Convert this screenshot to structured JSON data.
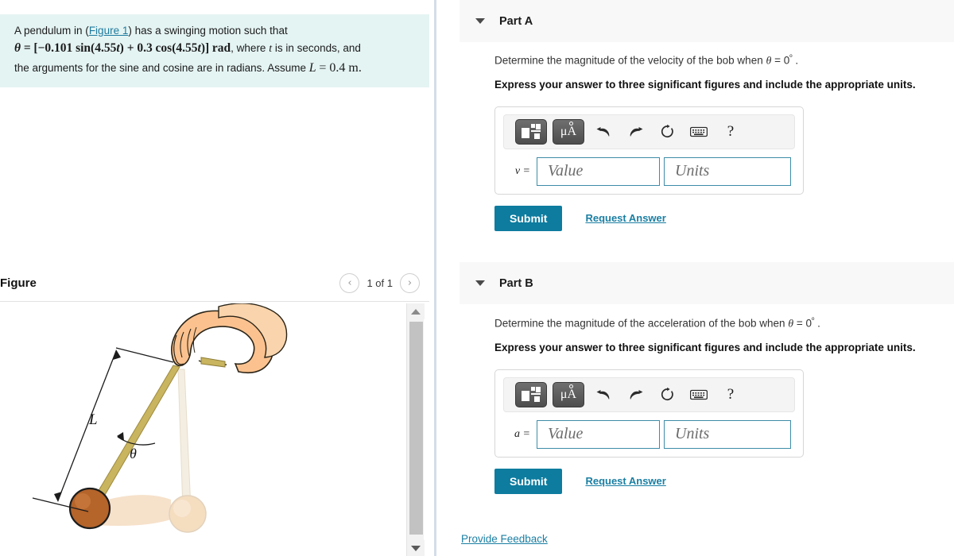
{
  "question": {
    "line1_pre": "A pendulum in (",
    "figure_link": "Figure 1",
    "line1_post": ") has a swinging motion such that",
    "theta_sym": "θ",
    "equals": "=",
    "equation": "[−0.101 sin(4.55t) + 0.3 cos(4.55t)] rad",
    "line2_post": ", where t is in seconds, and",
    "line3": "the arguments for the sine and cosine are in radians. Assume L = 0.4 m.",
    "eq_open": "[",
    "eq_neg": "−0.101",
    "eq_sin": "sin",
    "eq_arg1": "(4.55",
    "eq_t1": "t",
    "eq_plus": ") + 0.3",
    "eq_cos": "cos",
    "eq_arg2": "(4.55",
    "eq_t2": "t",
    "eq_close": ")]",
    "eq_rad": "rad",
    "where_text": ", where",
    "t_var": "t",
    "seconds_text": "is in seconds, and",
    "line3_a": "the arguments for the sine and cosine are in radians. Assume",
    "L_var": "L",
    "L_val": "= 0.4 m."
  },
  "figure": {
    "title": "Figure",
    "counter": "1 of 1",
    "prev_icon": "chevron-left-icon",
    "next_icon": "chevron-right-icon",
    "scroll_up_icon": "triangle-up-icon",
    "scroll_down_icon": "triangle-down-icon",
    "labels": {
      "length": "L",
      "angle": "θ"
    },
    "colors": {
      "string": "#c4b15c",
      "bob": "#b5642a",
      "bob_ghost": "#f0d9bd",
      "hand": "#fbc28f",
      "rod": "#f2ece0",
      "arc": "#e9c9a6"
    }
  },
  "toolbar": {
    "template_icon": "math-template-icon",
    "units_icon": "micro-angstrom-units-icon",
    "undo_icon": "undo-arrow-icon",
    "redo_icon": "redo-arrow-icon",
    "reset_icon": "reset-circular-arrow-icon",
    "keyboard_icon": "keyboard-icon",
    "help_icon": "question-mark-icon",
    "units_label": "μA",
    "help_label": "?"
  },
  "parts": [
    {
      "id": "part-a",
      "label": "Part A",
      "caret_icon": "caret-down-icon",
      "prompt_pre": "Determine the magnitude of the velocity of the bob when ",
      "prompt_theta": "θ",
      "prompt_eq": " = 0",
      "prompt_deg": "º",
      "prompt_end": " .",
      "instruction": "Express your answer to three significant figures and include the appropriate units.",
      "var_label": "v =",
      "value_placeholder": "Value",
      "units_placeholder": "Units",
      "value_current": "",
      "units_current": "",
      "submit_label": "Submit",
      "request_label": "Request Answer"
    },
    {
      "id": "part-b",
      "label": "Part B",
      "caret_icon": "caret-down-icon",
      "prompt_pre": "Determine the magnitude of the acceleration of the bob when ",
      "prompt_theta": "θ",
      "prompt_eq": " = 0",
      "prompt_deg": "º",
      "prompt_end": " .",
      "instruction": "Express your answer to three significant figures and include the appropriate units.",
      "var_label": "a =",
      "value_placeholder": "Value",
      "units_placeholder": "Units",
      "value_current": "",
      "units_current": "",
      "submit_label": "Submit",
      "request_label": "Request Answer"
    }
  ],
  "footer": {
    "feedback_label": "Provide Feedback"
  },
  "colors": {
    "accent_teal": "#0d7c9f",
    "link_teal": "#1b7fa3",
    "question_bg": "#e4f4f3",
    "band_bg": "#f8f8f8",
    "field_border": "#3e8ca8"
  }
}
